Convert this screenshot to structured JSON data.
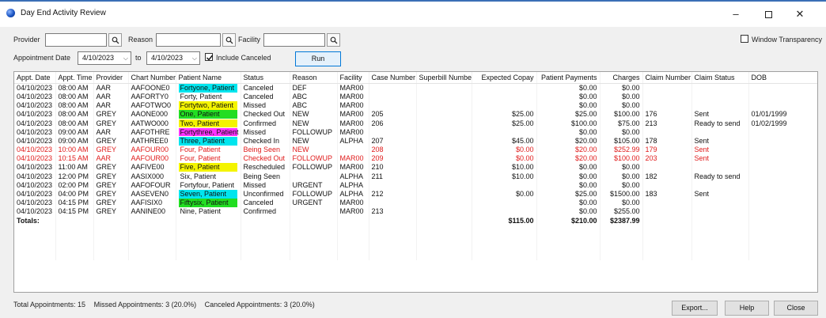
{
  "window": {
    "title": "Day End Activity Review",
    "controls": {
      "minimize": "–",
      "maximize": "☐",
      "close": "✕"
    }
  },
  "filters": {
    "provider_label": "Provider",
    "provider_value": "",
    "reason_label": "Reason",
    "reason_value": "",
    "facility_label": "Facility",
    "facility_value": "",
    "appointment_date_label": "Appointment Date",
    "date_from": "4/10/2023",
    "to_label": "to",
    "date_to": "4/10/2023",
    "include_canceled_label": "Include Canceled",
    "include_canceled_checked": true,
    "run_label": "Run",
    "window_transparency_label": "Window Transparency",
    "window_transparency_checked": false
  },
  "grid": {
    "columns": [
      "Appt. Date",
      "Appt. Time",
      "Provider",
      "Chart Number",
      "Patient Name",
      "Status",
      "Reason",
      "Facility",
      "Case Number",
      "Superbill Number",
      "Expected Copay",
      "Patient Payments",
      "Charges",
      "Claim Number",
      "Claim Status",
      "DOB"
    ],
    "rows": [
      {
        "date": "04/10/2023",
        "time": "08:00 AM",
        "provider": "AAR",
        "chart": "AAFOONE0",
        "name": "Fortyone, Patient",
        "name_color": "#00e5ee",
        "status": "Canceled",
        "reason": "DEF",
        "facility": "MAR00",
        "case": "",
        "superbill": "",
        "copay": "",
        "payments": "$0.00",
        "payments_red": false,
        "charges": "$0.00",
        "claim": "",
        "claim_status": "",
        "dob": "",
        "red": false
      },
      {
        "date": "04/10/2023",
        "time": "08:00 AM",
        "provider": "AAR",
        "chart": "AAFORTY0",
        "name": "Forty, Patient",
        "name_color": "",
        "status": "Canceled",
        "reason": "ABC",
        "facility": "MAR00",
        "case": "",
        "superbill": "",
        "copay": "",
        "payments": "$0.00",
        "payments_red": false,
        "charges": "$0.00",
        "claim": "",
        "claim_status": "",
        "dob": "",
        "red": false
      },
      {
        "date": "04/10/2023",
        "time": "08:00 AM",
        "provider": "AAR",
        "chart": "AAFOTWO0",
        "name": "Fortytwo, Patient",
        "name_color": "#f4f400",
        "status": "Missed",
        "reason": "ABC",
        "facility": "MAR00",
        "case": "",
        "superbill": "",
        "copay": "",
        "payments": "$0.00",
        "payments_red": false,
        "charges": "$0.00",
        "claim": "",
        "claim_status": "",
        "dob": "",
        "red": false
      },
      {
        "date": "04/10/2023",
        "time": "08:00 AM",
        "provider": "GREY",
        "chart": "AAONE000",
        "name": "One, Patient",
        "name_color": "#22dd22",
        "status": "Checked Out",
        "reason": "NEW",
        "facility": "MAR00",
        "case": "205",
        "superbill": "",
        "copay": "$25.00",
        "payments": "$25.00",
        "payments_red": false,
        "charges": "$100.00",
        "claim": "176",
        "claim_status": "Sent",
        "dob": "01/01/1999",
        "red": false
      },
      {
        "date": "04/10/2023",
        "time": "08:00 AM",
        "provider": "GREY",
        "chart": "AATWO000",
        "name": "Two, Patient",
        "name_color": "#f4f400",
        "status": "Confirmed",
        "reason": "NEW",
        "facility": "MAR00",
        "case": "206",
        "superbill": "",
        "copay": "$25.00",
        "payments": "$100.00",
        "payments_red": false,
        "charges": "$75.00",
        "claim": "213",
        "claim_status": "Ready to send",
        "dob": "01/02/1999",
        "red": false
      },
      {
        "date": "04/10/2023",
        "time": "09:00 AM",
        "provider": "AAR",
        "chart": "AAFOTHRE",
        "name": "Fortythree, Patient",
        "name_color": "#ff33ff",
        "status": "Missed",
        "reason": "FOLLOWUP",
        "facility": "MAR00",
        "case": "",
        "superbill": "",
        "copay": "",
        "payments": "$0.00",
        "payments_red": false,
        "charges": "$0.00",
        "claim": "",
        "claim_status": "",
        "dob": "",
        "red": false
      },
      {
        "date": "04/10/2023",
        "time": "09:00 AM",
        "provider": "GREY",
        "chart": "AATHREE0",
        "name": "Three, Patient",
        "name_color": "#00e5ee",
        "status": "Checked In",
        "reason": "NEW",
        "facility": "ALPHA",
        "case": "207",
        "superbill": "",
        "copay": "$45.00",
        "payments": "$20.00",
        "payments_red": false,
        "charges": "$105.00",
        "claim": "178",
        "claim_status": "Sent",
        "dob": "",
        "red": false
      },
      {
        "date": "04/10/2023",
        "time": "10:00 AM",
        "provider": "GREY",
        "chart": "AAFOUR00",
        "name": "Four, Patient",
        "name_color": "",
        "status": "Being Seen",
        "reason": "NEW",
        "facility": "",
        "case": "208",
        "superbill": "",
        "copay": "$0.00",
        "payments": "$20.00",
        "payments_red": true,
        "charges": "$252.99",
        "claim": "179",
        "claim_status": "Sent",
        "dob": "",
        "red": true
      },
      {
        "date": "04/10/2023",
        "time": "10:15 AM",
        "provider": "AAR",
        "chart": "AAFOUR00",
        "name": "Four, Patient",
        "name_color": "",
        "status": "Checked Out",
        "reason": "FOLLOWUP",
        "facility": "MAR00",
        "case": "209",
        "superbill": "",
        "copay": "$0.00",
        "payments": "$20.00",
        "payments_red": true,
        "charges": "$100.00",
        "claim": "203",
        "claim_status": "Sent",
        "dob": "",
        "red": true
      },
      {
        "date": "04/10/2023",
        "time": "11:00 AM",
        "provider": "GREY",
        "chart": "AAFIVE00",
        "name": "Five, Patient",
        "name_color": "#f4f400",
        "status": "Rescheduled",
        "reason": "FOLLOWUP",
        "facility": "MAR00",
        "case": "210",
        "superbill": "",
        "copay": "$10.00",
        "payments": "$0.00",
        "payments_red": false,
        "charges": "$0.00",
        "claim": "",
        "claim_status": "",
        "dob": "",
        "red": false
      },
      {
        "date": "04/10/2023",
        "time": "12:00 PM",
        "provider": "GREY",
        "chart": "AASIX000",
        "name": "Six, Patient",
        "name_color": "",
        "status": "Being Seen",
        "reason": "",
        "facility": "ALPHA",
        "case": "211",
        "superbill": "",
        "copay": "$10.00",
        "payments": "$0.00",
        "payments_red": false,
        "charges": "$0.00",
        "claim": "182",
        "claim_status": "Ready to send",
        "dob": "",
        "red": false
      },
      {
        "date": "04/10/2023",
        "time": "02:00 PM",
        "provider": "GREY",
        "chart": "AAFOFOUR",
        "name": "Fortyfour, Patient",
        "name_color": "",
        "status": "Missed",
        "reason": "URGENT",
        "facility": "ALPHA",
        "case": "",
        "superbill": "",
        "copay": "",
        "payments": "$0.00",
        "payments_red": false,
        "charges": "$0.00",
        "claim": "",
        "claim_status": "",
        "dob": "",
        "red": false
      },
      {
        "date": "04/10/2023",
        "time": "04:00 PM",
        "provider": "GREY",
        "chart": "AASEVEN0",
        "name": "Seven, Patient",
        "name_color": "#00e5ee",
        "status": "Unconfirmed",
        "reason": "FOLLOWUP",
        "facility": "ALPHA",
        "case": "212",
        "superbill": "",
        "copay": "$0.00",
        "payments": "$25.00",
        "payments_red": false,
        "charges": "$1500.00",
        "claim": "183",
        "claim_status": "Sent",
        "dob": "",
        "red": false
      },
      {
        "date": "04/10/2023",
        "time": "04:15 PM",
        "provider": "GREY",
        "chart": "AAFISIX0",
        "name": "Fiftysix, Patient",
        "name_color": "#22dd22",
        "status": "Canceled",
        "reason": "URGENT",
        "facility": "MAR00",
        "case": "",
        "superbill": "",
        "copay": "",
        "payments": "$0.00",
        "payments_red": false,
        "charges": "$0.00",
        "claim": "",
        "claim_status": "",
        "dob": "",
        "red": false
      },
      {
        "date": "04/10/2023",
        "time": "04:15 PM",
        "provider": "GREY",
        "chart": "AANINE00",
        "name": "Nine, Patient",
        "name_color": "",
        "status": "Confirmed",
        "reason": "",
        "facility": "MAR00",
        "case": "213",
        "superbill": "",
        "copay": "",
        "payments": "$0.00",
        "payments_red": false,
        "charges": "$255.00",
        "claim": "",
        "claim_status": "",
        "dob": "",
        "red": false
      }
    ],
    "totals": {
      "label": "Totals:",
      "copay": "$115.00",
      "payments": "$210.00",
      "charges": "$2387.99"
    }
  },
  "status": {
    "total": "Total Appointments: 15",
    "missed": "Missed Appointments: 3 (20.0%)",
    "canceled": "Canceled Appointments: 3 (20.0%)"
  },
  "buttons": {
    "export": "Export...",
    "help": "Help",
    "close": "Close"
  },
  "icons": {
    "app": "app-globe-icon",
    "picker": "search-picker-icon",
    "check": "checkmark-icon"
  }
}
